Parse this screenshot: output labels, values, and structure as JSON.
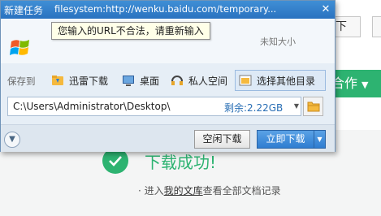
{
  "background": {
    "top_button_label": "下",
    "green_button_label": "合作",
    "success_text": "下载成功!",
    "hint_prefix": "· 进入",
    "hint_link": "我的文库",
    "hint_suffix": "查看全部文档记录"
  },
  "dialog": {
    "title": "新建任务",
    "url": "filesystem:http://wenku.baidu.com/temporary...",
    "tooltip": "您输入的URL不合法，请重新输入",
    "size_text": "未知大小",
    "save_label": "保存到",
    "locations": [
      {
        "label": "迅雷下载",
        "icon": "xunlei-folder-icon"
      },
      {
        "label": "桌面",
        "icon": "desktop-icon"
      },
      {
        "label": "私人空间",
        "icon": "private-space-icon"
      },
      {
        "label": "选择其他目录",
        "icon": "other-folder-icon",
        "selected": true
      }
    ],
    "path": "C:\\Users\\Administrator\\Desktop\\",
    "free_space": "剩余:2.22GB",
    "buttons": {
      "later": "空闲下载",
      "now": "立即下载"
    }
  },
  "colors": {
    "title_bar": "#2a72c0",
    "accent_green": "#2db371",
    "free_space_blue": "#2a6fb5"
  }
}
